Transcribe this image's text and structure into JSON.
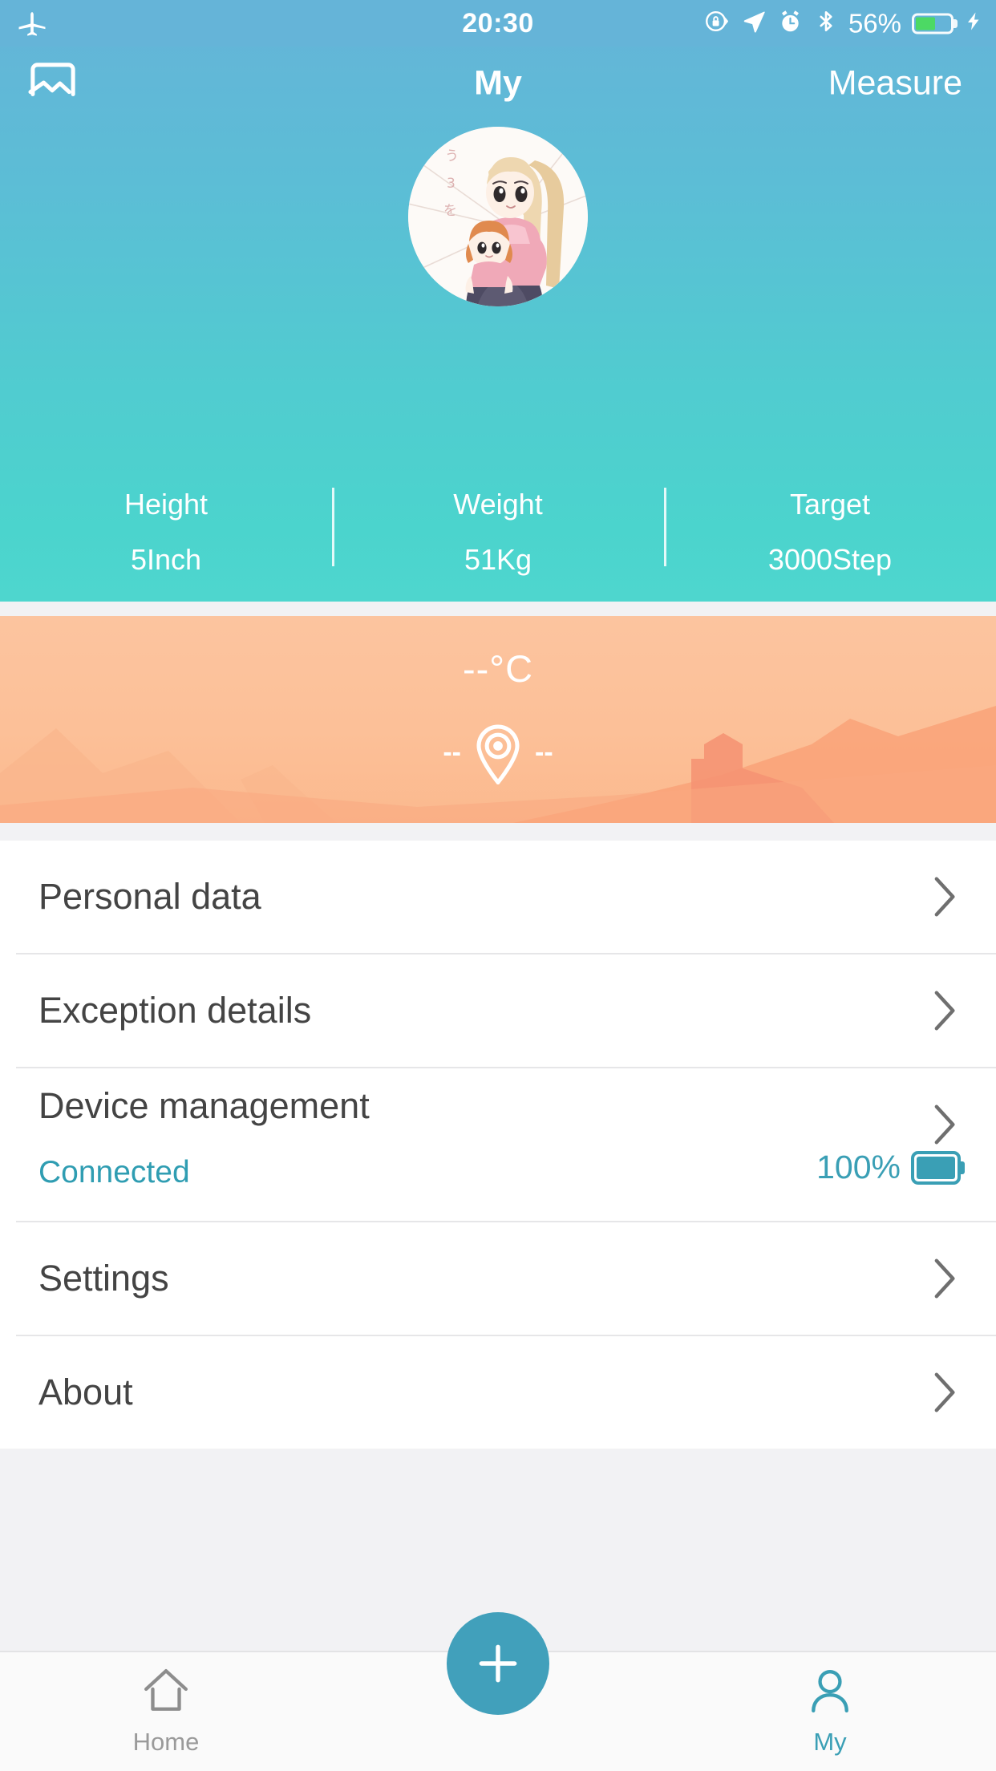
{
  "status_bar": {
    "airplane_icon": "airplane-mode-icon",
    "time": "20:30",
    "rotation_lock_icon": "rotation-lock-icon",
    "location_icon": "location-arrow-icon",
    "alarm_icon": "alarm-clock-icon",
    "bluetooth_icon": "bluetooth-icon",
    "battery_percent": "56%",
    "battery_level": 56,
    "charging_icon": "lightning-bolt-icon"
  },
  "navbar": {
    "left_icon": "chart-history-icon",
    "title": "My",
    "right_action": "Measure"
  },
  "profile": {
    "avatar": "user-avatar-anime-illustration",
    "stats": [
      {
        "label": "Height",
        "value": "5Inch"
      },
      {
        "label": "Weight",
        "value": "51Kg"
      },
      {
        "label": "Target",
        "value": "3000Step"
      }
    ]
  },
  "weather": {
    "temperature": "--°C",
    "location_left": "--",
    "location_icon": "location-pin-icon",
    "location_right": "--"
  },
  "menu": {
    "items": [
      {
        "label": "Personal data",
        "chevron": "chevron-right-icon"
      },
      {
        "label": "Exception details",
        "chevron": "chevron-right-icon"
      },
      {
        "label": "Device management",
        "status": "Connected",
        "battery_percent": "100%",
        "battery_level": 100,
        "chevron": "chevron-right-icon"
      },
      {
        "label": "Settings",
        "chevron": "chevron-right-icon"
      },
      {
        "label": "About",
        "chevron": "chevron-right-icon"
      }
    ]
  },
  "tabbar": {
    "tabs": [
      {
        "label": "Home",
        "icon": "home-icon",
        "active": false
      },
      {
        "label": "My",
        "icon": "person-icon",
        "active": true
      }
    ],
    "add_button": {
      "icon": "plus-icon",
      "label": "+"
    }
  },
  "colors": {
    "header_top": "#65b4d8",
    "header_bottom": "#4ed6ce",
    "accent_teal": "#3a9fb5",
    "weather_orange": "#fcc49f",
    "battery_green": "#4cd964"
  }
}
